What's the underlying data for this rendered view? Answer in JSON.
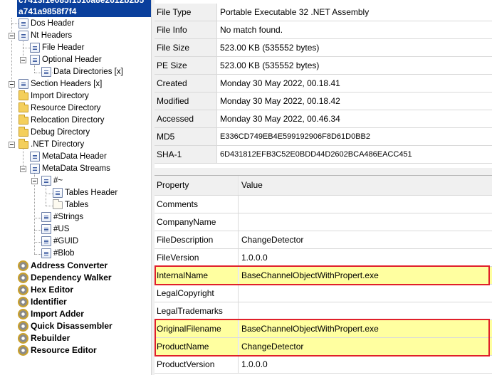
{
  "tree": {
    "selected_lines": [
      "c7413f1e085f1510a8e2612b2b5",
      "a741a9858f7f4"
    ],
    "items": [
      {
        "label": "Dos Header",
        "icon": "doc-icon",
        "depth": 1
      },
      {
        "label": "Nt Headers",
        "icon": "doc-icon",
        "depth": 1,
        "expanded": true
      },
      {
        "label": "File Header",
        "icon": "doc-icon",
        "depth": 2
      },
      {
        "label": "Optional Header",
        "icon": "doc-icon",
        "depth": 2,
        "expanded": true
      },
      {
        "label": "Data Directories [x]",
        "icon": "doc-icon",
        "depth": 3
      },
      {
        "label": "Section Headers [x]",
        "icon": "doc-icon",
        "depth": 1
      },
      {
        "label": "Import Directory",
        "icon": "folder-icon",
        "depth": 1
      },
      {
        "label": "Resource Directory",
        "icon": "folder-icon",
        "depth": 1
      },
      {
        "label": "Relocation Directory",
        "icon": "folder-icon",
        "depth": 1
      },
      {
        "label": "Debug Directory",
        "icon": "folder-icon",
        "depth": 1
      },
      {
        "label": ".NET Directory",
        "icon": "folder-icon",
        "depth": 1,
        "expanded": true
      },
      {
        "label": "MetaData Header",
        "icon": "doc-icon",
        "depth": 2
      },
      {
        "label": "MetaData Streams",
        "icon": "doc-icon",
        "depth": 2,
        "expanded": true
      },
      {
        "label": "#~",
        "icon": "doc-icon",
        "depth": 3,
        "expanded": true
      },
      {
        "label": "Tables Header",
        "icon": "doc-icon",
        "depth": 4
      },
      {
        "label": "Tables",
        "icon": "empty-folder-icon",
        "depth": 4
      },
      {
        "label": "#Strings",
        "icon": "doc-icon",
        "depth": 3
      },
      {
        "label": "#US",
        "icon": "doc-icon",
        "depth": 3
      },
      {
        "label": "#GUID",
        "icon": "doc-icon",
        "depth": 3
      },
      {
        "label": "#Blob",
        "icon": "doc-icon",
        "depth": 3
      }
    ],
    "tools": [
      "Address Converter",
      "Dependency Walker",
      "Hex Editor",
      "Identifier",
      "Import Adder",
      "Quick Disassembler",
      "Rebuilder",
      "Resource Editor"
    ]
  },
  "info": [
    {
      "key": "File Type",
      "value": "Portable Executable 32 .NET Assembly"
    },
    {
      "key": "File Info",
      "value": "No match found."
    },
    {
      "key": "File Size",
      "value": "523.00 KB (535552 bytes)"
    },
    {
      "key": "PE Size",
      "value": "523.00 KB (535552 bytes)"
    },
    {
      "key": "Created",
      "value": "Monday 30 May 2022, 00.18.41"
    },
    {
      "key": "Modified",
      "value": "Monday 30 May 2022, 00.18.42"
    },
    {
      "key": "Accessed",
      "value": "Monday 30 May 2022, 00.46.34"
    },
    {
      "key": "MD5",
      "value": "E336CD749EB4E599192906F8D61D0BB2"
    },
    {
      "key": "SHA-1",
      "value": "6D431812EFB3C52E0BDD44D2602BCA486EACC451"
    }
  ],
  "props": {
    "headers": [
      "Property",
      "Value"
    ],
    "rows": [
      {
        "key": "Comments",
        "value": "",
        "highlight": false
      },
      {
        "key": "CompanyName",
        "value": "",
        "highlight": false
      },
      {
        "key": "FileDescription",
        "value": "ChangeDetector",
        "highlight": false
      },
      {
        "key": "FileVersion",
        "value": "1.0.0.0",
        "highlight": false
      },
      {
        "key": "InternalName",
        "value": "BaseChannelObjectWithPropert.exe",
        "highlight": true
      },
      {
        "key": "LegalCopyright",
        "value": "",
        "highlight": false
      },
      {
        "key": "LegalTrademarks",
        "value": "",
        "highlight": false
      },
      {
        "key": "OriginalFilename",
        "value": "BaseChannelObjectWithPropert.exe",
        "highlight": true
      },
      {
        "key": "ProductName",
        "value": "ChangeDetector",
        "highlight": true
      },
      {
        "key": "ProductVersion",
        "value": "1.0.0.0",
        "highlight": false
      }
    ]
  },
  "colors": {
    "selection": "#0a3f9c",
    "highlight": "#ffffa0",
    "callout_border": "#e0202a"
  }
}
